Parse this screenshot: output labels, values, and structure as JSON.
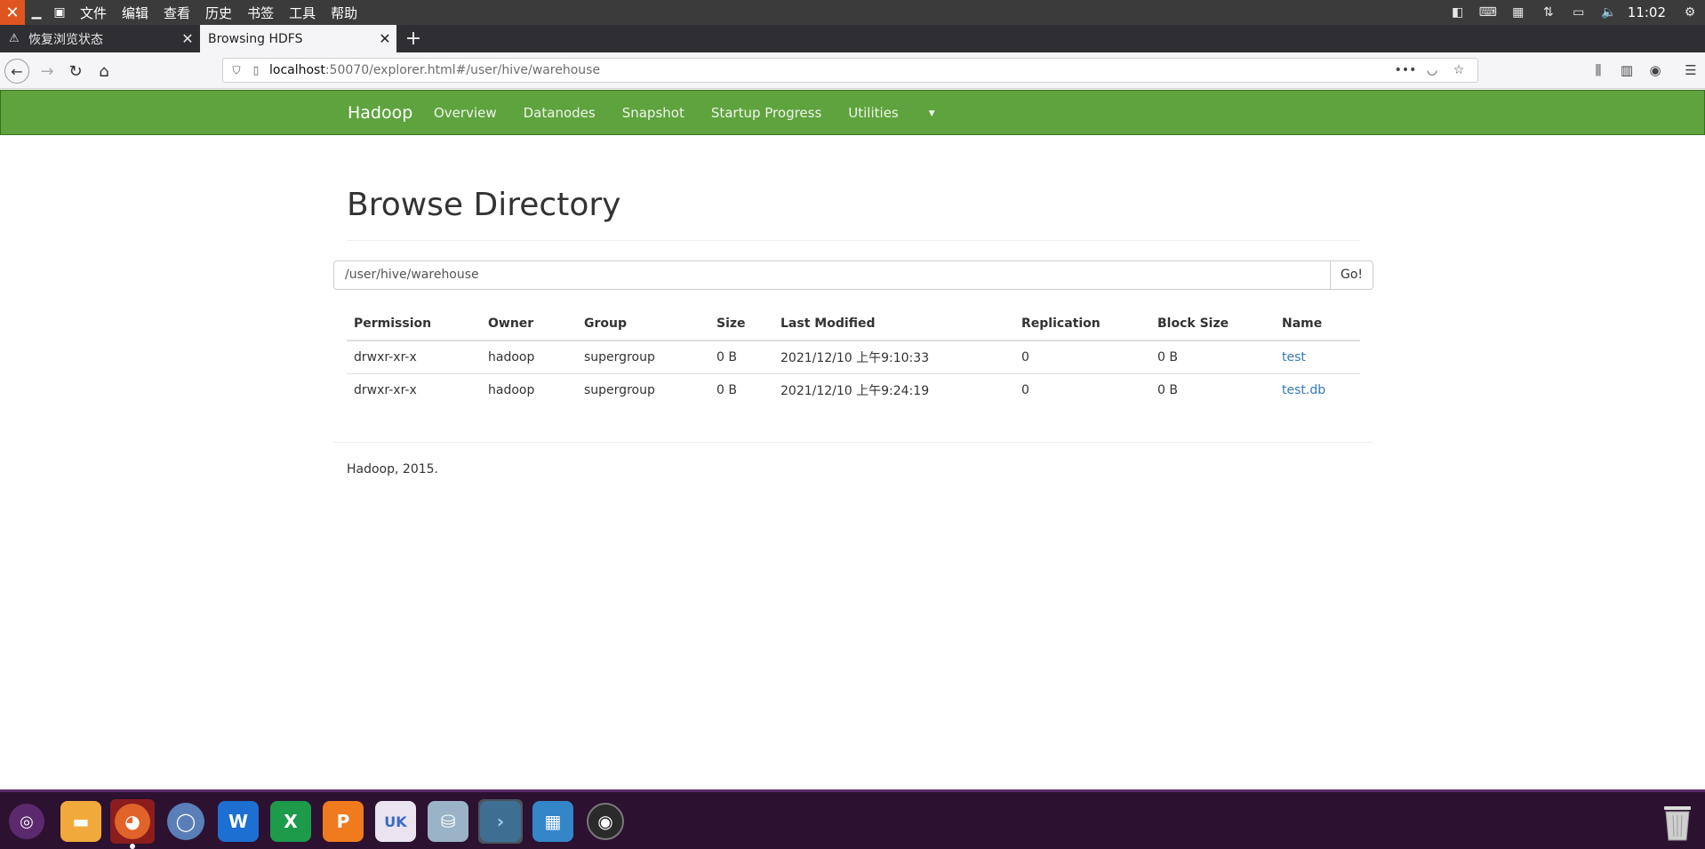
{
  "system": {
    "menu": [
      "文件",
      "编辑",
      "查看",
      "历史",
      "书签",
      "工具",
      "帮助"
    ],
    "time": "11:02"
  },
  "tabs": [
    {
      "title": "恢复浏览状态",
      "icon": "warning-icon"
    },
    {
      "title": "Browsing HDFS",
      "icon": ""
    }
  ],
  "address": {
    "host": "localhost",
    "rest": ":50070/explorer.html#/user/hive/warehouse"
  },
  "hadoop_nav": {
    "brand": "Hadoop",
    "links": [
      "Overview",
      "Datanodes",
      "Snapshot",
      "Startup Progress",
      "Utilities"
    ]
  },
  "page": {
    "title": "Browse Directory",
    "path_value": "/user/hive/warehouse",
    "go_label": "Go!",
    "footer": "Hadoop, 2015."
  },
  "table": {
    "headers": [
      "Permission",
      "Owner",
      "Group",
      "Size",
      "Last Modified",
      "Replication",
      "Block Size",
      "Name"
    ],
    "rows": [
      {
        "permission": "drwxr-xr-x",
        "owner": "hadoop",
        "group": "supergroup",
        "size": "0 B",
        "modified": "2021/12/10 上午9:10:33",
        "replication": "0",
        "block_size": "0 B",
        "name": "test"
      },
      {
        "permission": "drwxr-xr-x",
        "owner": "hadoop",
        "group": "supergroup",
        "size": "0 B",
        "modified": "2021/12/10 上午9:24:19",
        "replication": "0",
        "block_size": "0 B",
        "name": "test.db"
      }
    ]
  },
  "colors": {
    "hadoop_green": "#5fa33e",
    "link_blue": "#337ab7",
    "dock_bg": "#2c1131"
  }
}
